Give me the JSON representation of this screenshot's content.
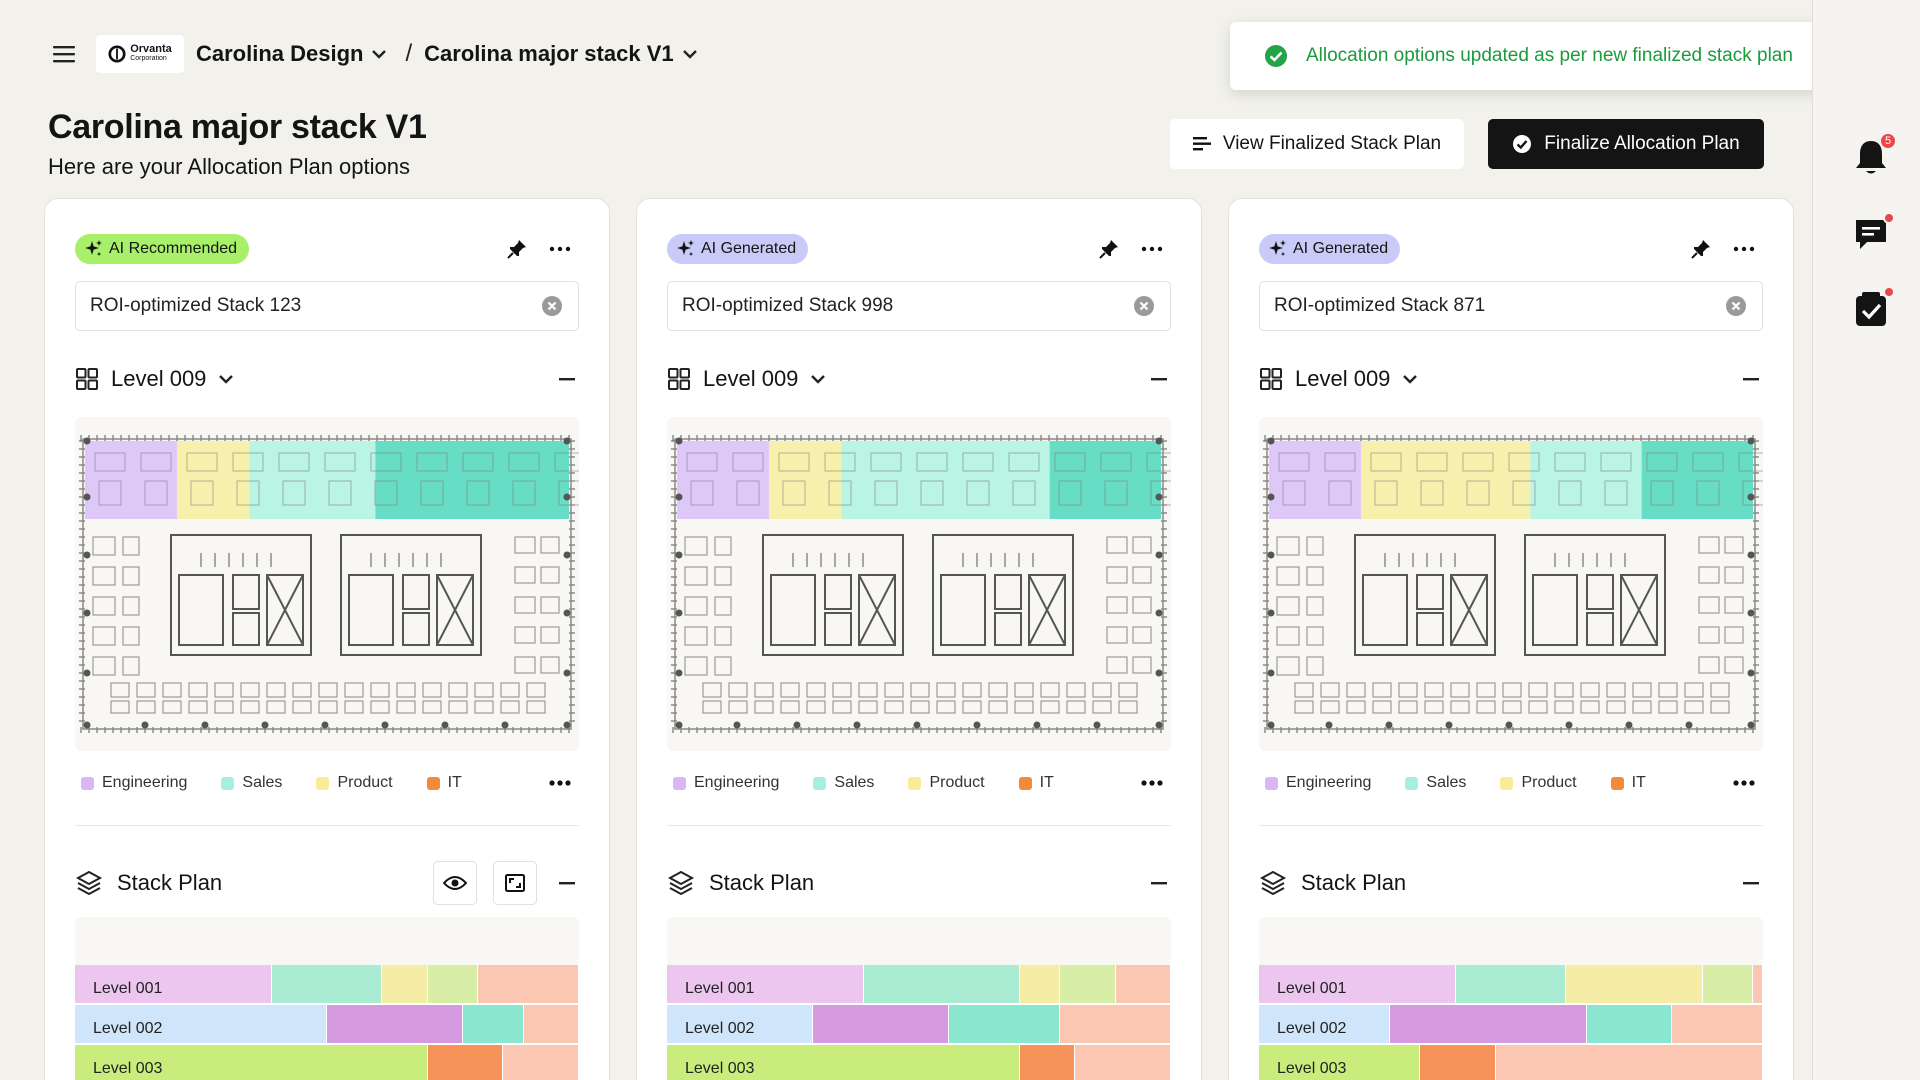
{
  "header": {
    "org": "Carolina Design",
    "project": "Carolina major stack V1",
    "logo": {
      "name": "Orvanta",
      "sub": "Corporation"
    }
  },
  "toast": {
    "message": "Allocation options updated as per new finalized stack plan",
    "color": "#1c9a3d"
  },
  "page": {
    "title": "Carolina major stack V1",
    "subtitle": "Here are your Allocation Plan options"
  },
  "actions": {
    "view_finalized": "View Finalized Stack Plan",
    "finalize": "Finalize Allocation Plan"
  },
  "rail": {
    "notification_count": "5"
  },
  "legend": [
    {
      "label": "Engineering",
      "color": "#d5b8f5"
    },
    {
      "label": "Sales",
      "color": "#a6f0e0"
    },
    {
      "label": "Product",
      "color": "#f6ec9a"
    },
    {
      "label": "IT",
      "color": "#f58a3a"
    }
  ],
  "cards": [
    {
      "badge": "AI Recommended",
      "badge_type": "recommended",
      "name": "ROI-optimized Stack 123",
      "level": "Level 009",
      "stack_title": "Stack Plan",
      "floor_zones": [
        {
          "color": "#d8bff7",
          "share": 0.19
        },
        {
          "color": "#f7ee9f",
          "share": 0.15
        },
        {
          "color": "#aef3e2",
          "share": 0.26
        },
        {
          "color": "#4fd8bd",
          "share": 0.4
        }
      ],
      "stack_levels": [
        {
          "label": "Level 001",
          "segments": [
            {
              "color": "#ecc6ef",
              "share": 0.39
            },
            {
              "color": "#a9ecd3",
              "share": 0.22
            },
            {
              "color": "#f5eca6",
              "share": 0.09
            },
            {
              "color": "#d8eea7",
              "share": 0.1
            },
            {
              "color": "#fcc7b2",
              "share": 0.2
            }
          ]
        },
        {
          "label": "Level 002",
          "segments": [
            {
              "color": "#cfe6fa",
              "share": 0.5
            },
            {
              "color": "#d69ae0",
              "share": 0.27
            },
            {
              "color": "#8be6d0",
              "share": 0.12
            },
            {
              "color": "#fcc7b2",
              "share": 0.11
            }
          ]
        },
        {
          "label": "Level 003",
          "segments": [
            {
              "color": "#c9ec7c",
              "share": 0.7
            },
            {
              "color": "#f7925a",
              "share": 0.15
            },
            {
              "color": "#fcc7b2",
              "share": 0.15
            }
          ]
        }
      ]
    },
    {
      "badge": "AI Generated",
      "badge_type": "generated",
      "name": "ROI-optimized Stack 998",
      "level": "Level 009",
      "stack_title": "Stack Plan",
      "floor_zones": [
        {
          "color": "#d8bff7",
          "share": 0.19
        },
        {
          "color": "#f7ee9f",
          "share": 0.15
        },
        {
          "color": "#aef3e2",
          "share": 0.43
        },
        {
          "color": "#4fd8bd",
          "share": 0.23
        }
      ],
      "stack_levels": [
        {
          "label": "Level 001",
          "segments": [
            {
              "color": "#ecc6ef",
              "share": 0.39
            },
            {
              "color": "#a9ecd3",
              "share": 0.31
            },
            {
              "color": "#f5eca6",
              "share": 0.08
            },
            {
              "color": "#d8eea7",
              "share": 0.11
            },
            {
              "color": "#fcc7b2",
              "share": 0.11
            }
          ]
        },
        {
          "label": "Level 002",
          "segments": [
            {
              "color": "#cfe6fa",
              "share": 0.29
            },
            {
              "color": "#d69ae0",
              "share": 0.27
            },
            {
              "color": "#8be6d0",
              "share": 0.22
            },
            {
              "color": "#fcc7b2",
              "share": 0.22
            }
          ]
        },
        {
          "label": "Level 003",
          "segments": [
            {
              "color": "#c9ec7c",
              "share": 0.7
            },
            {
              "color": "#f7925a",
              "share": 0.11
            },
            {
              "color": "#fcc7b2",
              "share": 0.19
            }
          ]
        }
      ]
    },
    {
      "badge": "AI Generated",
      "badge_type": "generated",
      "name": "ROI-optimized Stack 871",
      "level": "Level 009",
      "stack_title": "Stack Plan",
      "floor_zones": [
        {
          "color": "#d8bff7",
          "share": 0.19
        },
        {
          "color": "#f7ee9f",
          "share": 0.35
        },
        {
          "color": "#aef3e2",
          "share": 0.23
        },
        {
          "color": "#4fd8bd",
          "share": 0.23
        }
      ],
      "stack_levels": [
        {
          "label": "Level 001",
          "segments": [
            {
              "color": "#ecc6ef",
              "share": 0.39
            },
            {
              "color": "#a9ecd3",
              "share": 0.22
            },
            {
              "color": "#f5eca6",
              "share": 0.27
            },
            {
              "color": "#d8eea7",
              "share": 0.1
            },
            {
              "color": "#fcc7b2",
              "share": 0.02
            }
          ]
        },
        {
          "label": "Level 002",
          "segments": [
            {
              "color": "#cfe6fa",
              "share": 0.26
            },
            {
              "color": "#d69ae0",
              "share": 0.39
            },
            {
              "color": "#8be6d0",
              "share": 0.17
            },
            {
              "color": "#fcc7b2",
              "share": 0.18
            }
          ]
        },
        {
          "label": "Level 003",
          "segments": [
            {
              "color": "#c9ec7c",
              "share": 0.32
            },
            {
              "color": "#f7925a",
              "share": 0.15
            },
            {
              "color": "#fcc7b2",
              "share": 0.53
            }
          ]
        }
      ]
    }
  ]
}
